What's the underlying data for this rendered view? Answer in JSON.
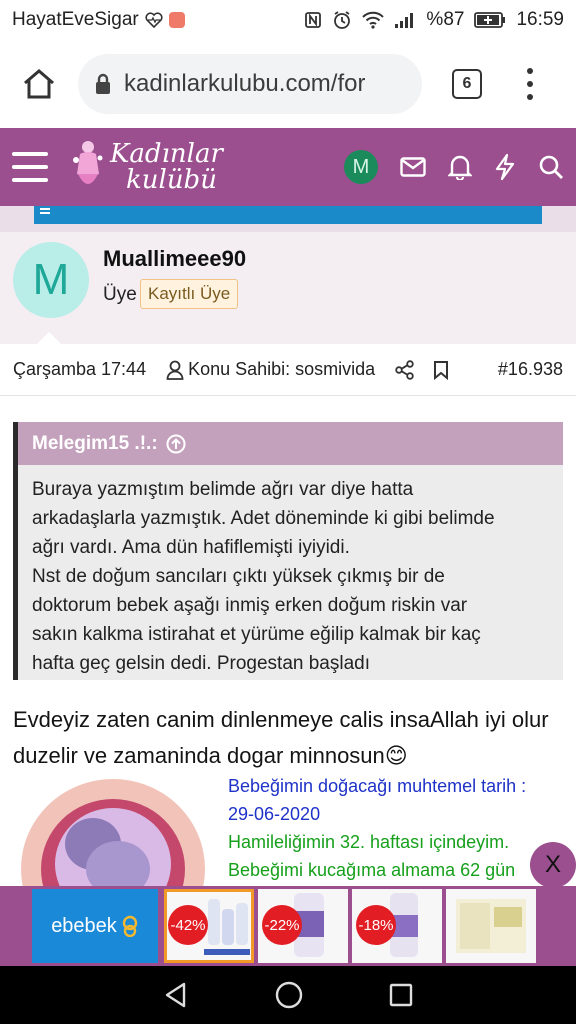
{
  "status_bar": {
    "carrier": "HayatEveSigar",
    "battery": "%87",
    "time": "16:59"
  },
  "browser": {
    "url": "kadinlarkulubu.com/for",
    "tab_count": "6"
  },
  "site": {
    "logo_line1": "Kadınlar",
    "logo_line2": "kulübü",
    "user_initial": "M"
  },
  "post": {
    "avatar_initial": "M",
    "username": "Muallimeee90",
    "role": "Üye",
    "badge": "Kayıtlı Üye",
    "date": "Çarşamba 17:44",
    "author_label": "Konu Sahibi: sosmivida",
    "post_number": "#16.938",
    "quote": {
      "author": "Melegim15 .!.:",
      "lines": [
        "Buraya yazmıştım belimde ağrı var diye hatta",
        "arkadaşlarla yazmıştık. Adet döneminde ki gibi belimde",
        "ağrı vardı. Ama dün hafiflemişti iyiyidi.",
        "Nst de doğum sancıları çıktı yüksek çıkmış bir de",
        "doktorum bebek aşağı inmiş erken doğum riskin var",
        "sakın kalkma istirahat et yürüme eğilip kalmak bir kaç",
        "hafta geç gelsin dedi. Progestan başladı"
      ]
    },
    "message": "Evdeyiz zaten canim dinlenmeye calis insaAllah iyi olur duzelir ve zamaninda dogar minnosun",
    "emoji": "😊",
    "ticker": {
      "line1": "Bebeğimin doğacağı muhtemel tarih :",
      "line2": "29-06-2020",
      "line3": "Hamileliğimin 32. haftası içindeyim.",
      "line4": "Bebeğimi kucağıma almama 62 gün"
    }
  },
  "ad": {
    "brand": "ebebek",
    "close_label": "X",
    "tiles": [
      {
        "discount": "-42%"
      },
      {
        "discount": "-22%"
      },
      {
        "discount": "-18%"
      },
      {
        "discount": ""
      }
    ]
  },
  "colors": {
    "brand_purple": "#9b4f8e",
    "quote_header": "#c3a1bc",
    "ebebek_blue": "#1a89d8",
    "discount_red": "#e21d23"
  }
}
